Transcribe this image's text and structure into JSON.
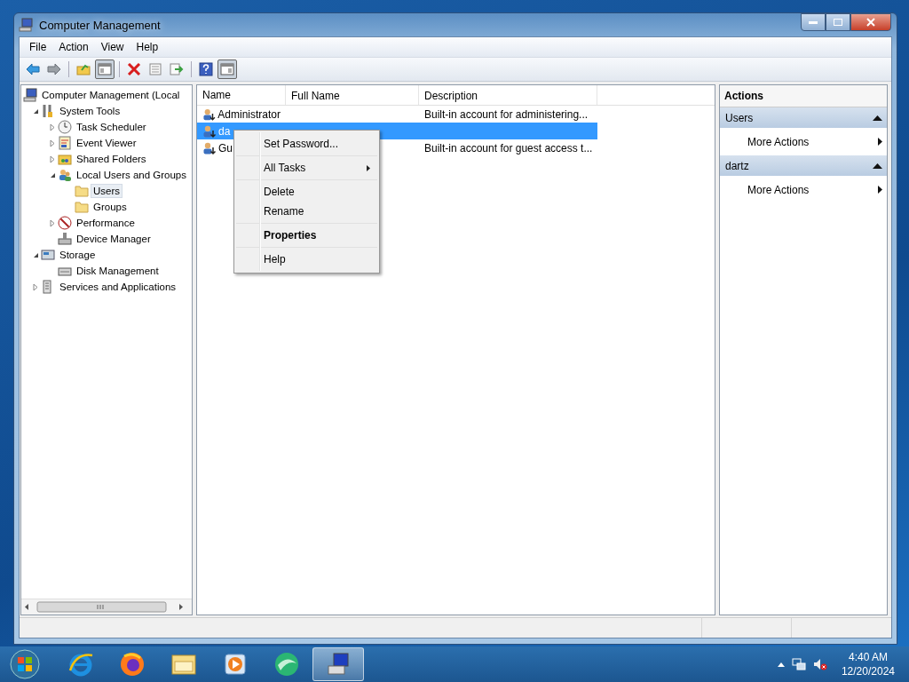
{
  "window": {
    "title": "Computer Management"
  },
  "menu_bar": [
    "File",
    "Action",
    "View",
    "Help"
  ],
  "toolbar": [
    {
      "kind": "back",
      "pressed": false
    },
    {
      "kind": "forward",
      "pressed": false
    },
    {
      "kind": "separator"
    },
    {
      "kind": "up-folder",
      "pressed": false
    },
    {
      "kind": "tree-pane",
      "pressed": true
    },
    {
      "kind": "separator"
    },
    {
      "kind": "delete",
      "pressed": false
    },
    {
      "kind": "properties",
      "pressed": false
    },
    {
      "kind": "export",
      "pressed": false
    },
    {
      "kind": "separator"
    },
    {
      "kind": "help",
      "pressed": false
    },
    {
      "kind": "action-pane",
      "pressed": true
    }
  ],
  "tree": [
    {
      "label": "Computer Management (Local",
      "kind": "computer",
      "selected": false,
      "children": [
        {
          "label": "System Tools",
          "kind": "tools",
          "expanded": true,
          "selected": false,
          "children": [
            {
              "label": "Task Scheduler",
              "kind": "clock",
              "expanded": false,
              "selected": false
            },
            {
              "label": "Event Viewer",
              "kind": "viewer",
              "expanded": false,
              "selected": false
            },
            {
              "label": "Shared Folders",
              "kind": "shared",
              "expanded": false,
              "selected": false
            },
            {
              "label": "Local Users and Groups",
              "kind": "users",
              "expanded": true,
              "selected": false,
              "children": [
                {
                  "label": "Users",
                  "kind": "folder",
                  "selected": true
                },
                {
                  "label": "Groups",
                  "kind": "folder",
                  "selected": false
                }
              ]
            },
            {
              "label": "Performance",
              "kind": "performance",
              "expanded": false,
              "selected": false
            },
            {
              "label": "Device Manager",
              "kind": "device",
              "selected": false
            }
          ]
        },
        {
          "label": "Storage",
          "kind": "storage",
          "expanded": true,
          "selected": false,
          "children": [
            {
              "label": "Disk Management",
              "kind": "disk",
              "selected": false
            }
          ]
        },
        {
          "label": "Services and Applications",
          "kind": "services",
          "expanded": false,
          "selected": false
        }
      ]
    }
  ],
  "table": {
    "columns": [
      "Name",
      "Full Name",
      "Description"
    ],
    "rows": [
      {
        "name": "Administrator",
        "full_name": "",
        "description": "Built-in account for administering...",
        "selected": false
      },
      {
        "name": "da",
        "full_name": "",
        "description": "",
        "selected": true
      },
      {
        "name": "Gu",
        "full_name": "",
        "description": "Built-in account for guest access t...",
        "selected": false
      }
    ]
  },
  "context_menu": {
    "groups": [
      [
        {
          "label": "Set Password...",
          "default": false,
          "submenu": false
        }
      ],
      [
        {
          "label": "All Tasks",
          "default": false,
          "submenu": true
        }
      ],
      [
        {
          "label": "Delete",
          "default": false,
          "submenu": false
        },
        {
          "label": "Rename",
          "default": false,
          "submenu": false
        }
      ],
      [
        {
          "label": "Properties",
          "default": true,
          "submenu": false
        }
      ],
      [
        {
          "label": "Help",
          "default": false,
          "submenu": false
        }
      ]
    ]
  },
  "actions": {
    "title": "Actions",
    "sections": [
      {
        "title": "Users",
        "expanded": true,
        "items": [
          "More Actions"
        ]
      },
      {
        "title": "dartz",
        "expanded": true,
        "items": [
          "More Actions"
        ]
      }
    ]
  },
  "taskbar": {
    "items": [
      {
        "kind": "ie",
        "selected": false
      },
      {
        "kind": "firefox",
        "selected": false
      },
      {
        "kind": "explorer",
        "selected": false
      },
      {
        "kind": "media",
        "selected": false
      },
      {
        "kind": "green",
        "selected": false
      },
      {
        "kind": "compmgmt",
        "selected": true
      }
    ],
    "time": "4:40 AM",
    "date": "12/20/2024"
  }
}
